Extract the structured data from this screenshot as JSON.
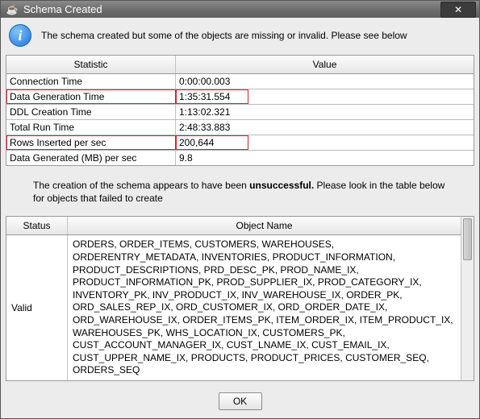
{
  "titlebar": {
    "icon": "☕",
    "title": "Schema Created",
    "close": "✕"
  },
  "message": "The schema created but some of the objects are missing or invalid. Please see below",
  "stats": {
    "header": {
      "stat": "Statistic",
      "val": "Value"
    },
    "rows": [
      {
        "stat": "Connection Time",
        "val": "0:00:00.003",
        "hl": false
      },
      {
        "stat": "Data Generation Time",
        "val": "1:35:31.554",
        "hl": true
      },
      {
        "stat": "DDL Creation Time",
        "val": "1:13:02.321",
        "hl": false
      },
      {
        "stat": "Total Run Time",
        "val": "2:48:33.883",
        "hl": false
      },
      {
        "stat": "Rows Inserted per sec",
        "val": "200,644",
        "hl": true
      },
      {
        "stat": "Data Generated (MB) per sec",
        "val": "9.8",
        "hl": false
      }
    ]
  },
  "note": {
    "pre": "The creation of the schema appears to have been ",
    "bold": "unsuccessful.",
    "post": " Please look in the table below for objects that failed to create"
  },
  "objects": {
    "header": {
      "status": "Status",
      "name": "Object Name"
    },
    "rows": [
      {
        "status": "Valid",
        "name": "ORDERS, ORDER_ITEMS, CUSTOMERS, WAREHOUSES, ORDERENTRY_METADATA, INVENTORIES, PRODUCT_INFORMATION, PRODUCT_DESCRIPTIONS, PRD_DESC_PK, PROD_NAME_IX, PRODUCT_INFORMATION_PK, PROD_SUPPLIER_IX, PROD_CATEGORY_IX, INVENTORY_PK, INV_PRODUCT_IX, INV_WAREHOUSE_IX, ORDER_PK, ORD_SALES_REP_IX, ORD_CUSTOMER_IX, ORD_ORDER_DATE_IX, ORD_WAREHOUSE_IX, ORDER_ITEMS_PK, ITEM_ORDER_IX, ITEM_PRODUCT_IX, WAREHOUSES_PK, WHS_LOCATION_IX, CUSTOMERS_PK, CUST_ACCOUNT_MANAGER_IX, CUST_LNAME_IX, CUST_EMAIL_IX, CUST_UPPER_NAME_IX, PRODUCTS, PRODUCT_PRICES, CUSTOMER_SEQ, ORDERS_SEQ"
      }
    ]
  },
  "buttons": {
    "ok": "OK"
  }
}
